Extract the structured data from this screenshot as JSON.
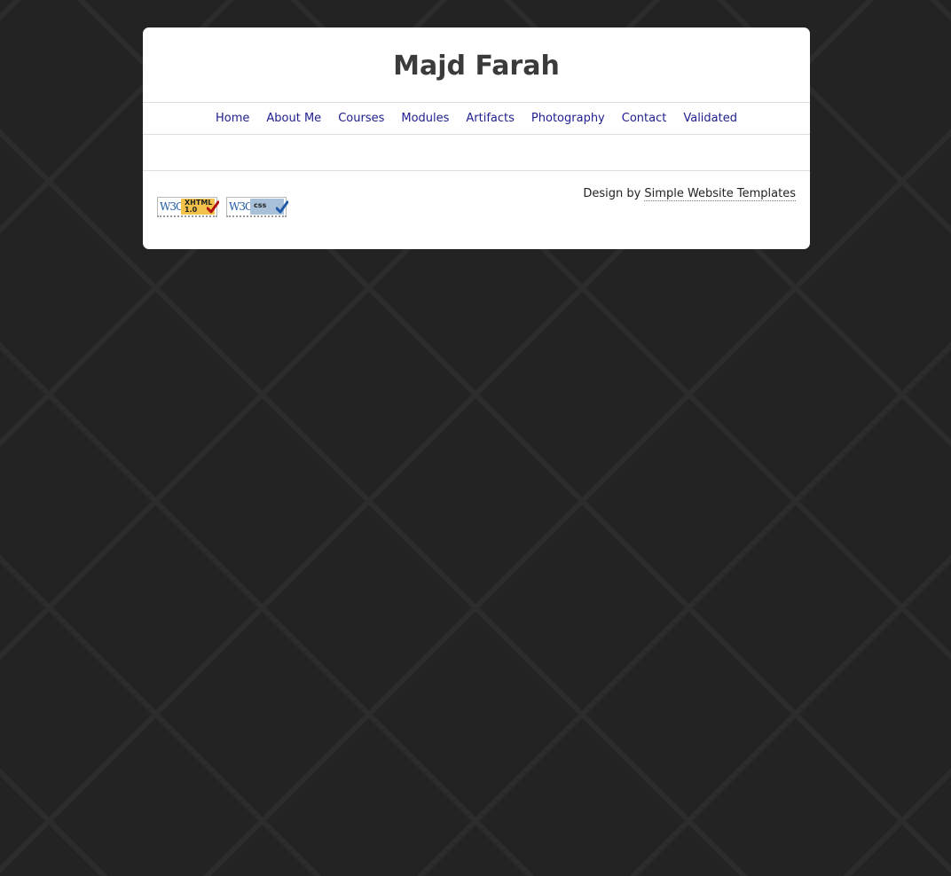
{
  "site": {
    "title": "Majd Farah"
  },
  "nav": {
    "items": [
      {
        "label": "Home"
      },
      {
        "label": "About Me"
      },
      {
        "label": "Courses"
      },
      {
        "label": "Modules"
      },
      {
        "label": "Artifacts"
      },
      {
        "label": "Photography"
      },
      {
        "label": "Contact"
      },
      {
        "label": "Validated"
      }
    ]
  },
  "footer": {
    "badges": {
      "xhtml": {
        "w3c": "W3C",
        "line1": "XHTML",
        "line2": "1.0",
        "icon": "checkmark-icon"
      },
      "css": {
        "w3c": "W3C",
        "line1": "css",
        "icon": "checkmark-icon"
      }
    },
    "credit_prefix": "Design by",
    "credit_link": "Simple Website Templates"
  },
  "colors": {
    "background": "#232323",
    "nav_link": "#1d1d8f",
    "title": "#3b3b3b",
    "xhtml_badge": "#f2c24a",
    "css_badge": "#a8c0d8",
    "xhtml_check": "#b01010",
    "css_check": "#1e5aa8"
  }
}
